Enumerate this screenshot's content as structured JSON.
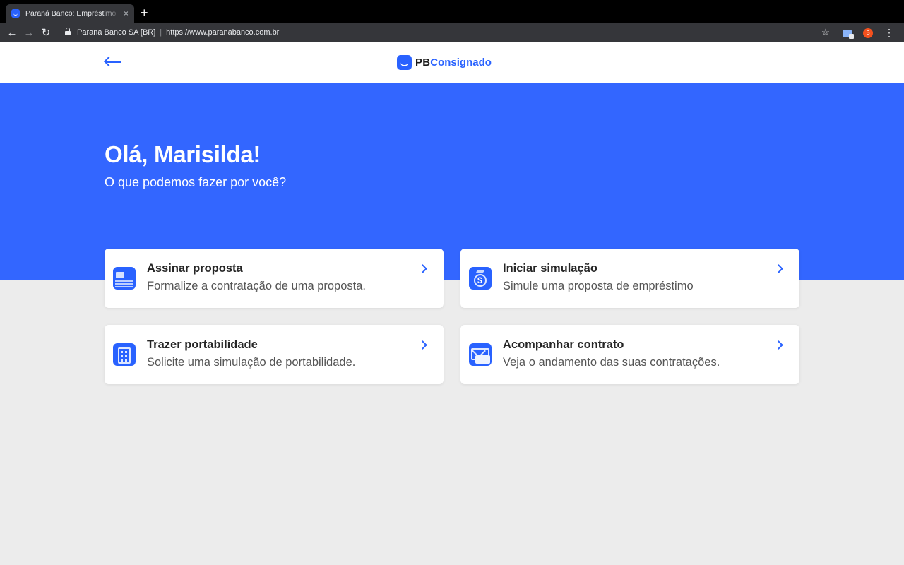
{
  "browser": {
    "tab_title": "Paraná Banco: Empréstimo Pessoal",
    "tab_close": "×",
    "new_tab": "+",
    "back": "←",
    "forward": "→",
    "reload": "↻",
    "site_name": "Parana Banco SA [BR]",
    "separator": "|",
    "url": "https://www.paranabanco.com.br",
    "bookmark": "☆",
    "profile_initial": "B",
    "menu": "⋮"
  },
  "header": {
    "logo_pb": "PB",
    "logo_text": "Consignado"
  },
  "hero": {
    "greeting": "Olá, Marisilda!",
    "subtitle": "O que podemos fazer por você?"
  },
  "cards": [
    {
      "title": "Assinar proposta",
      "description": "Formalize a contratação de uma proposta.",
      "icon": "document-icon"
    },
    {
      "title": "Iniciar simulação",
      "description": "Simule uma proposta de empréstimo",
      "icon": "money-icon"
    },
    {
      "title": "Trazer portabilidade",
      "description": "Solicite uma simulação de portabilidade.",
      "icon": "building-icon"
    },
    {
      "title": "Acompanhar contrato",
      "description": "Veja o andamento das suas contratações.",
      "icon": "envelope-icon"
    }
  ],
  "colors": {
    "brand_blue": "#3366ff",
    "accent_blue": "#2962ff",
    "page_background": "#ececec"
  }
}
